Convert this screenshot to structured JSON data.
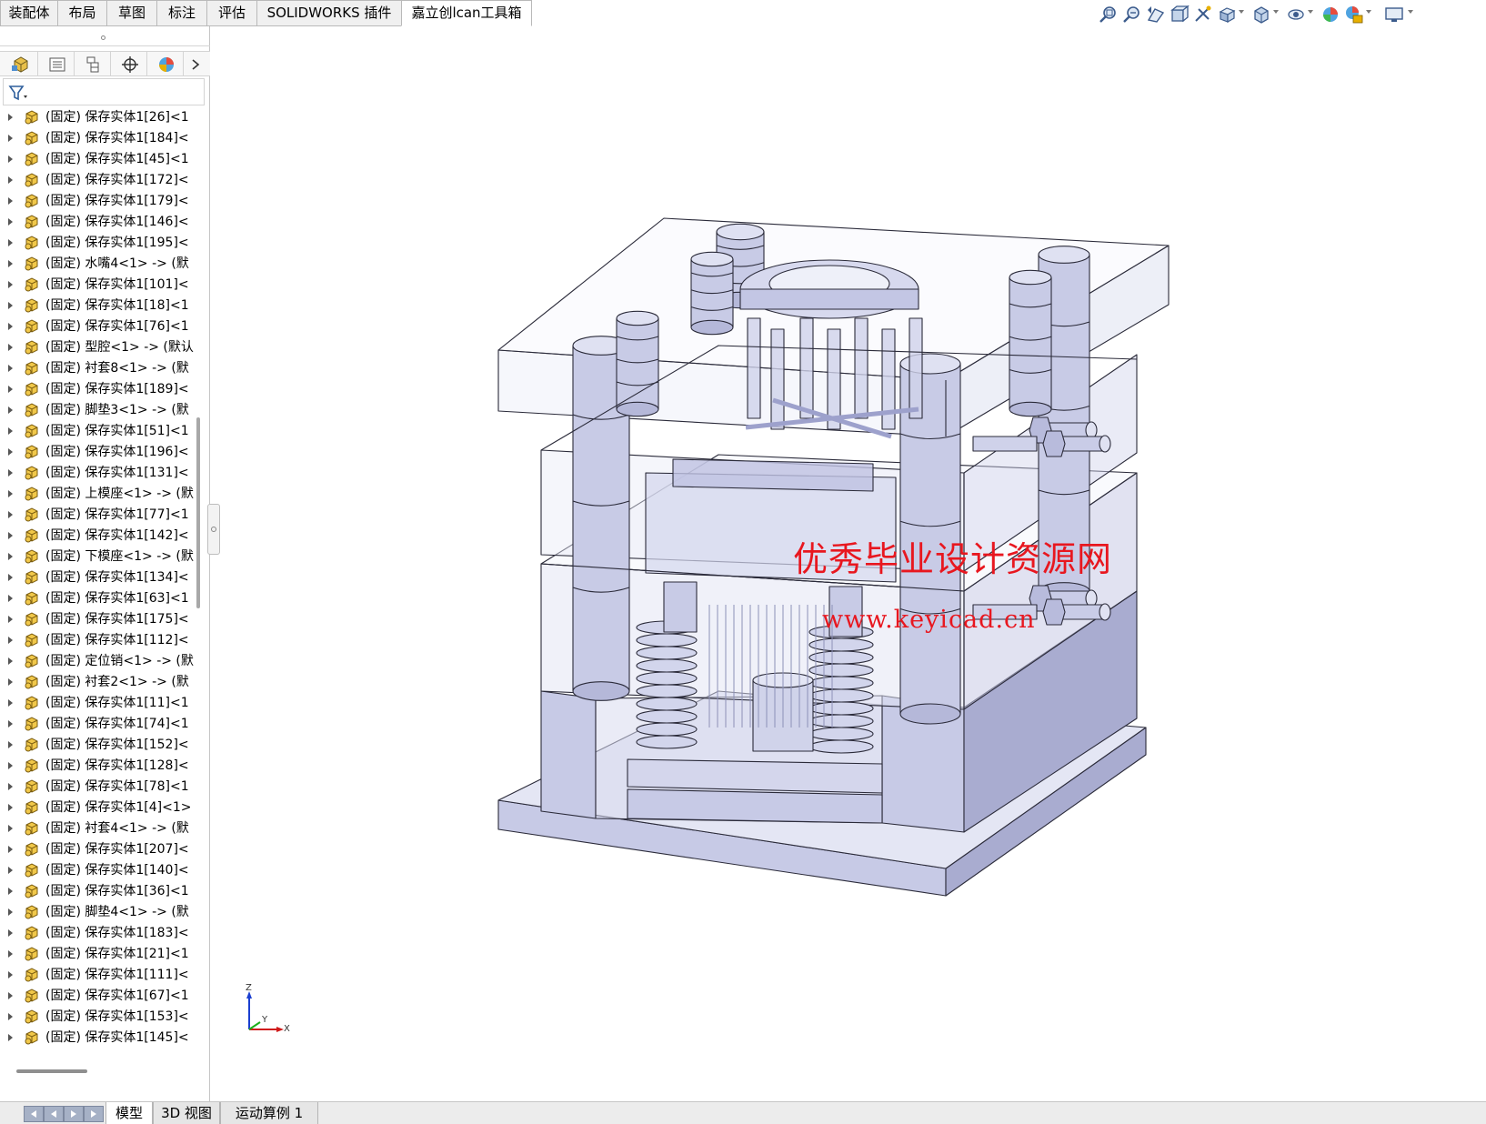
{
  "command_tabs": [
    {
      "label": "装配体",
      "active": false
    },
    {
      "label": "布局",
      "active": false
    },
    {
      "label": "草图",
      "active": false
    },
    {
      "label": "标注",
      "active": false
    },
    {
      "label": "评估",
      "active": false
    },
    {
      "label": "SOLIDWORKS 插件",
      "active": false
    },
    {
      "label": "嘉立创lcan工具箱",
      "active": true
    }
  ],
  "heads_up_toolbar": [
    "zoom-to-fit-icon",
    "zoom-to-area-icon",
    "previous-view-icon",
    "section-view-icon",
    "dynamic-annotation-icon",
    "view-orientation-icon",
    "display-style-icon",
    "hide-show-items-icon",
    "edit-appearance-icon",
    "apply-scene-icon",
    "view-settings-icon"
  ],
  "manager_tabs": [
    "featuremanager-tab-icon",
    "propertymanager-tab-icon",
    "configurationmanager-tab-icon",
    "dimxpertmanager-tab-icon",
    "displaymanager-tab-icon"
  ],
  "feature_tree": [
    "(固定) 保存实体1[26]<1",
    "(固定) 保存实体1[184]<",
    "(固定) 保存实体1[45]<1",
    "(固定) 保存实体1[172]<",
    "(固定) 保存实体1[179]<",
    "(固定) 保存实体1[146]<",
    "(固定) 保存实体1[195]<",
    "(固定) 水嘴4<1> -> (默",
    "(固定) 保存实体1[101]<",
    "(固定) 保存实体1[18]<1",
    "(固定) 保存实体1[76]<1",
    "(固定) 型腔<1> -> (默认",
    "(固定) 衬套8<1> -> (默",
    "(固定) 保存实体1[189]<",
    "(固定) 脚垫3<1> -> (默",
    "(固定) 保存实体1[51]<1",
    "(固定) 保存实体1[196]<",
    "(固定) 保存实体1[131]<",
    "(固定) 上模座<1> -> (默",
    "(固定) 保存实体1[77]<1",
    "(固定) 保存实体1[142]<",
    "(固定) 下模座<1> -> (默",
    "(固定) 保存实体1[134]<",
    "(固定) 保存实体1[63]<1",
    "(固定) 保存实体1[175]<",
    "(固定) 保存实体1[112]<",
    "(固定) 定位销<1> -> (默",
    "(固定) 衬套2<1> -> (默",
    "(固定) 保存实体1[11]<1",
    "(固定) 保存实体1[74]<1",
    "(固定) 保存实体1[152]<",
    "(固定) 保存实体1[128]<",
    "(固定) 保存实体1[78]<1",
    "(固定) 保存实体1[4]<1>",
    "(固定) 衬套4<1> -> (默",
    "(固定) 保存实体1[207]<",
    "(固定) 保存实体1[140]<",
    "(固定) 保存实体1[36]<1",
    "(固定) 脚垫4<1> -> (默",
    "(固定) 保存实体1[183]<",
    "(固定) 保存实体1[21]<1",
    "(固定) 保存实体1[111]<",
    "(固定) 保存实体1[67]<1",
    "(固定) 保存实体1[153]<",
    "(固定) 保存实体1[145]<"
  ],
  "bottom_tabs": [
    {
      "label": "模型",
      "active": true
    },
    {
      "label": "3D 视图",
      "active": false
    },
    {
      "label": "运动算例 1",
      "active": false
    }
  ],
  "watermark": {
    "line1": "优秀毕业设计资源网",
    "line2": "www.keyicad.cn"
  },
  "triad": {
    "z": "Z",
    "y": "Y",
    "x": "X"
  },
  "colors": {
    "part": "#c8cbe6",
    "part_edge": "#2b2b3a",
    "plate": "#d9dbef",
    "watermark": "#e8171f"
  }
}
